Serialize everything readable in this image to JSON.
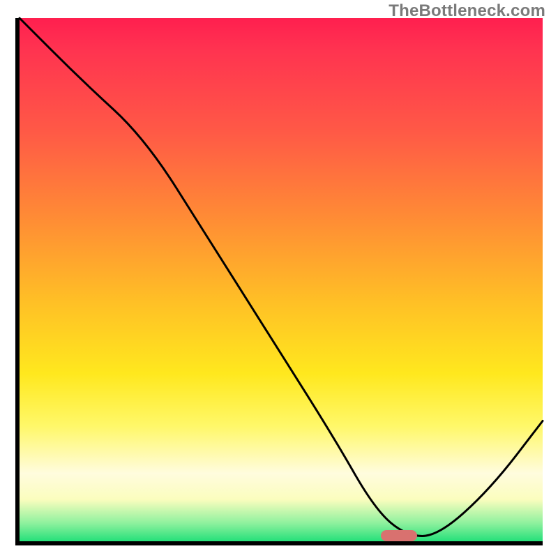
{
  "watermark": "TheBottleneck.com",
  "chart_data": {
    "type": "line",
    "title": "",
    "xlabel": "",
    "ylabel": "",
    "xlim": [
      0,
      100
    ],
    "ylim": [
      0,
      100
    ],
    "grid": false,
    "legend": false,
    "series": [
      {
        "name": "curve",
        "x": [
          0,
          12,
          24,
          36,
          48,
          60,
          68,
          74,
          80,
          90,
          100
        ],
        "y": [
          100,
          88,
          77,
          58,
          39,
          20,
          6,
          1,
          1,
          10,
          23
        ]
      }
    ],
    "marker": {
      "x": 72,
      "y": 1.8
    },
    "background_gradient": {
      "orientation": "vertical",
      "stops": [
        {
          "pos": 0.0,
          "color": "#ff1f4f"
        },
        {
          "pos": 0.22,
          "color": "#ff5a46"
        },
        {
          "pos": 0.54,
          "color": "#ffbf26"
        },
        {
          "pos": 0.78,
          "color": "#fff869"
        },
        {
          "pos": 0.92,
          "color": "#fbfdbe"
        },
        {
          "pos": 1.0,
          "color": "#25e07a"
        }
      ]
    }
  }
}
